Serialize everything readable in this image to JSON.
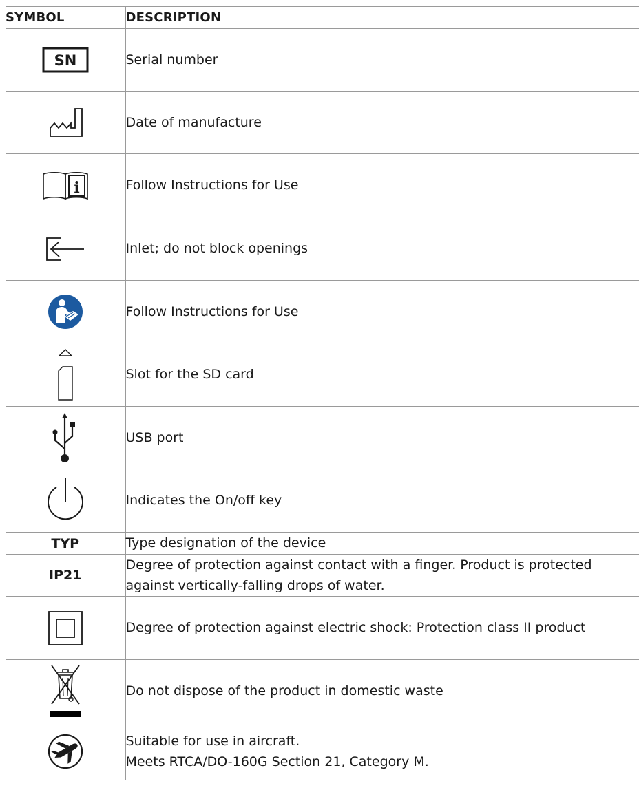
{
  "header": {
    "symbol": "SYMBOL",
    "description": "DESCRIPTION"
  },
  "rows": [
    {
      "icon": "serial-number-icon",
      "symbol_text": "SN",
      "description": "Serial number"
    },
    {
      "icon": "manufacture-date-icon",
      "description": "Date of manufacture"
    },
    {
      "icon": "instructions-book-icon",
      "description": "Follow Instructions for Use"
    },
    {
      "icon": "inlet-arrow-icon",
      "description": "Inlet; do not block openings"
    },
    {
      "icon": "mandatory-read-manual-icon",
      "color": "#1c5aa0",
      "description": "Follow Instructions for Use"
    },
    {
      "icon": "sd-card-slot-icon",
      "description": "Slot for the SD card"
    },
    {
      "icon": "usb-icon",
      "description": "USB port"
    },
    {
      "icon": "power-icon",
      "description": "Indicates the On/off key"
    },
    {
      "symbol_text": "TYP",
      "description": "Type designation of the device"
    },
    {
      "symbol_text": "IP21",
      "description_lines": [
        "Degree of protection against contact with a finger. Product is protected",
        "against vertically-falling drops of water."
      ]
    },
    {
      "icon": "protection-class-2-icon",
      "description": "Degree of protection against electric shock: Protection class II product"
    },
    {
      "icon": "crossed-bin-icon",
      "description": "Do not dispose of the product in domestic waste"
    },
    {
      "icon": "aircraft-icon",
      "description_lines": [
        "Suitable for use in aircraft.",
        "Meets RTCA/DO-160G Section 21, Category M."
      ]
    }
  ]
}
